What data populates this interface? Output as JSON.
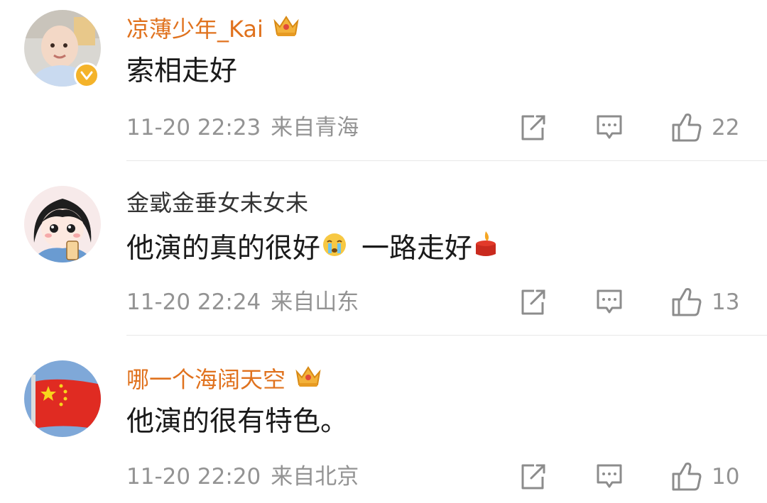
{
  "comments": [
    {
      "username": "凉薄少年_Kai",
      "text": "索相走好",
      "time": "11-20 22:23",
      "location": "来自青海",
      "likes": "22",
      "vip": true,
      "verified": true
    },
    {
      "username": "金戜金垂女未女未",
      "text_before": "他演的真的很好",
      "text_after": "一路走好",
      "emojis": [
        "crying-emoji",
        "candle-emoji"
      ],
      "time": "11-20 22:24",
      "location": "来自山东",
      "likes": "13",
      "vip": false
    },
    {
      "username": "哪一个海阔天空",
      "text": "他演的很有特色。",
      "time": "11-20 22:20",
      "location": "来自北京",
      "likes": "10",
      "vip": true
    }
  ],
  "colors": {
    "vip_name": "#e0721e",
    "normal_name": "#333333",
    "meta": "#939393",
    "divider": "#e8e8e8"
  }
}
